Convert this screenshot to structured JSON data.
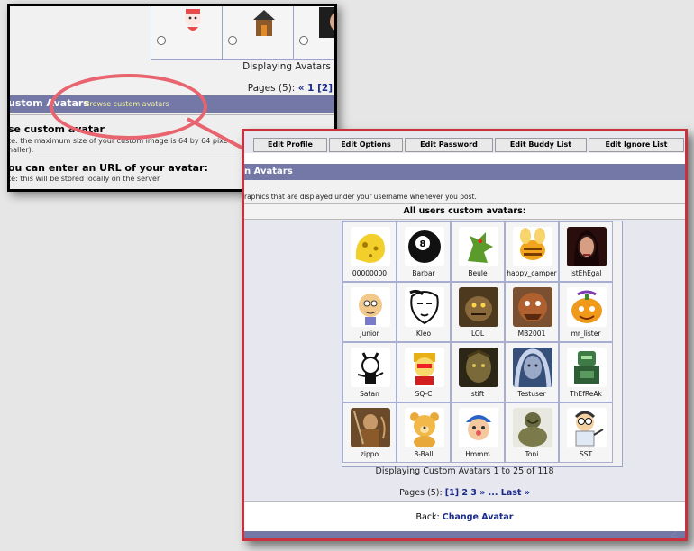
{
  "back_window": {
    "display_text": "Displaying Avatars",
    "pages_label": "Pages (5):",
    "pages_links": "« 1 [2]",
    "section_title": "ustom Avatars",
    "section_link": "Browse custom avatars",
    "use_custom_heading": "se custom avatar",
    "use_custom_note_1": "te: the maximum size of your custom image is 64 by 64 pixe",
    "use_custom_note_2": "naller).",
    "url_heading": "ou can enter an URL of your avatar:",
    "url_note": "te: this will be stored locally on the server"
  },
  "front_window": {
    "tabs": [
      "Edit Profile",
      "Edit Options",
      "Edit Password",
      "Edit Buddy List",
      "Edit Ignore List"
    ],
    "section_title": "n Avatars",
    "description": "raphics that are displayed under your username whenever you post.",
    "grid_title": "All users custom avatars:",
    "avatars": [
      {
        "name": "00000000",
        "icon": "yellow-blob-avatar"
      },
      {
        "name": "Barbar",
        "icon": "eight-ball-avatar"
      },
      {
        "name": "Beule",
        "icon": "green-dragon-avatar"
      },
      {
        "name": "happy_camper",
        "icon": "bee-avatar"
      },
      {
        "name": "IstEhEgal",
        "icon": "woman-portrait-avatar"
      },
      {
        "name": "Junior",
        "icon": "cartoon-boy-avatar"
      },
      {
        "name": "Kleo",
        "icon": "sketch-face-avatar"
      },
      {
        "name": "LOL",
        "icon": "creature-avatar"
      },
      {
        "name": "MB2001",
        "icon": "orc-avatar"
      },
      {
        "name": "mr_lister",
        "icon": "pumpkin-avatar"
      },
      {
        "name": "Satan",
        "icon": "cartoon-devil-avatar"
      },
      {
        "name": "SQ-C",
        "icon": "red-cartoon-avatar"
      },
      {
        "name": "stift",
        "icon": "dark-fantasy-avatar"
      },
      {
        "name": "Testuser",
        "icon": "blue-woman-avatar"
      },
      {
        "name": "ThEfReAk",
        "icon": "green-robot-avatar"
      },
      {
        "name": "zippo",
        "icon": "warrior-avatar"
      },
      {
        "name": "8-Ball",
        "icon": "teddy-bear-avatar"
      },
      {
        "name": "Hmmm",
        "icon": "cartoon-kid-avatar"
      },
      {
        "name": "Toni",
        "icon": "buddha-avatar"
      },
      {
        "name": "SST",
        "icon": "scientist-avatar"
      }
    ],
    "display_text": "Displaying Custom Avatars 1 to 25 of 118",
    "pages_label": "Pages (5):",
    "pages_links": "[1] 2 3 » ... Last »",
    "back_label": "Back:",
    "back_link": "Change Avatar"
  },
  "colors": {
    "header_bar": "#7478a6",
    "highlight_ring": "#e8646f",
    "front_border": "#c8323e",
    "link": "#1a2a88"
  }
}
